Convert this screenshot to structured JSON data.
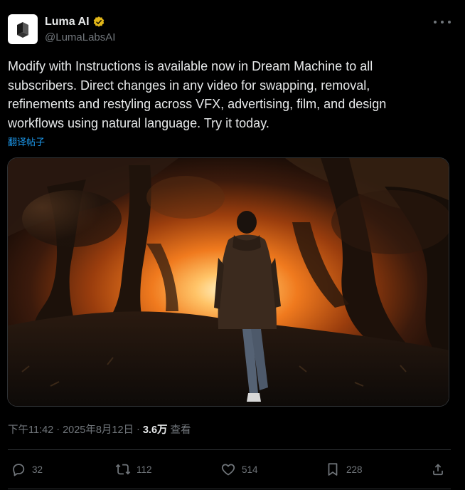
{
  "author": {
    "display_name": "Luma AI",
    "handle": "@LumaLabsAI",
    "verified_color": "#e2b719"
  },
  "tweet": {
    "text": "Modify with Instructions is available now in Dream Machine to all\nsubscribers. Direct changes in any video for swapping, removal,\nrefinements and restyling across VFX, advertising, film, and design\nworkflows using natural language. Try it today.",
    "translate_label": "翻译帖子",
    "media_description_icon": "video-thumbnail"
  },
  "meta": {
    "time": "下午11:42",
    "separator1": "·",
    "date": "2025年8月12日",
    "separator2": "·",
    "views_count": "3.6万",
    "views_label": "查看"
  },
  "actions": {
    "reply_count": "32",
    "retweet_count": "112",
    "like_count": "514",
    "bookmark_count": "228"
  },
  "colors": {
    "background": "#000000",
    "text_primary": "#e7e9ea",
    "text_secondary": "#71767b",
    "link": "#1d9bf0",
    "border": "#2f3336"
  }
}
